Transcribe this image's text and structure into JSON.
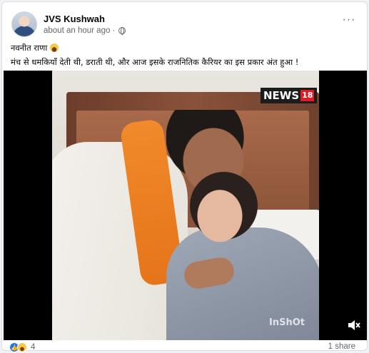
{
  "post": {
    "author": "JVS Kushwah",
    "time": "about an hour ago",
    "privacy_dot": "·",
    "more_label": "···",
    "text_line1": "नवनीत राणा",
    "text_line2": "मंच से धमकियाँ देती थी, डराती थी, और आज इसके राजनितिक कैरियर का इस प्रकार अंत हुआ !"
  },
  "video": {
    "channel_logo": "NEWS",
    "channel_number": "18",
    "watermark": "InShOt",
    "mute_icon": "speaker-muted-icon"
  },
  "footer": {
    "reaction_count": "4",
    "shares": "1 share"
  },
  "colors": {
    "like_blue": "#1877f2",
    "secondary_text": "#65676b",
    "scarf_orange": "#f08a2a"
  }
}
